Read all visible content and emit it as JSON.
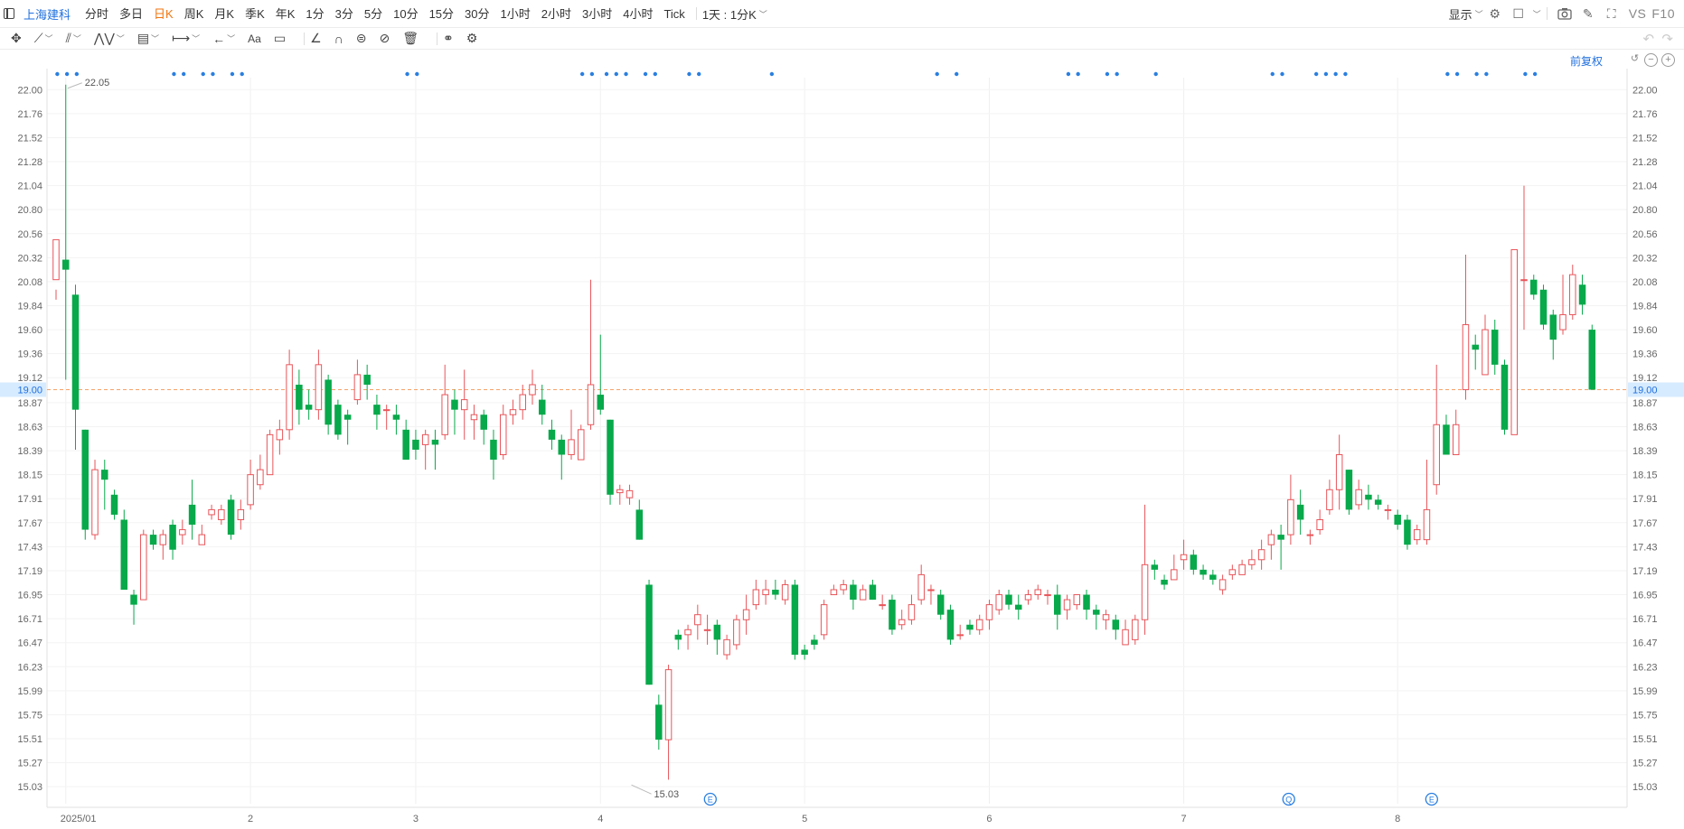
{
  "toolbar": {
    "symbol": "上海建科",
    "intervals": [
      "分时",
      "多日",
      "日K",
      "周K",
      "月K",
      "季K",
      "年K",
      "1分",
      "3分",
      "5分",
      "10分",
      "15分",
      "30分",
      "1小时",
      "2小时",
      "3小时",
      "4小时",
      "Tick"
    ],
    "active_interval": "日K",
    "range_label": "1天 : 1分K",
    "display_label": "显示",
    "vs_label": "VS",
    "f10_label": "F10"
  },
  "chart_header": {
    "adjust_label": "前复权"
  },
  "chart_data": {
    "type": "candlestick",
    "y_ticks": [
      22.0,
      21.76,
      21.52,
      21.28,
      21.04,
      20.8,
      20.56,
      20.32,
      20.08,
      19.84,
      19.6,
      19.36,
      19.12,
      18.87,
      18.63,
      18.39,
      18.15,
      17.91,
      17.67,
      17.43,
      17.19,
      16.95,
      16.71,
      16.47,
      16.23,
      15.99,
      15.75,
      15.51,
      15.27,
      15.03
    ],
    "ylim": [
      14.86,
      22.12
    ],
    "x_labels": [
      {
        "label": "2025/01",
        "i": 1
      },
      {
        "label": "2",
        "i": 20
      },
      {
        "label": "3",
        "i": 37
      },
      {
        "label": "4",
        "i": 56
      },
      {
        "label": "5",
        "i": 77
      },
      {
        "label": "6",
        "i": 96
      },
      {
        "label": "7",
        "i": 116
      },
      {
        "label": "8",
        "i": 138
      }
    ],
    "current_price": 19.0,
    "high_marker": {
      "value": "22.05",
      "i": 1
    },
    "low_marker": {
      "value": "15.03",
      "i": 59
    },
    "up_color": "#e8555a",
    "down_color": "#07a94a",
    "price_line_color": "#f5a36a",
    "candles": [
      [
        20.1,
        20.5,
        19.9,
        20.0
      ],
      [
        20.3,
        20.2,
        19.1,
        22.05
      ],
      [
        19.95,
        18.8,
        18.4,
        20.05
      ],
      [
        18.6,
        17.6,
        17.5,
        18.6
      ],
      [
        17.55,
        18.2,
        17.5,
        18.3
      ],
      [
        18.2,
        18.1,
        17.8,
        18.3
      ],
      [
        17.95,
        17.75,
        17.7,
        18.0
      ],
      [
        17.7,
        17.0,
        17.0,
        17.8
      ],
      [
        16.95,
        16.85,
        16.65,
        17.0
      ],
      [
        16.9,
        17.55,
        16.9,
        17.6
      ],
      [
        17.55,
        17.45,
        17.4,
        17.6
      ],
      [
        17.45,
        17.55,
        17.3,
        17.6
      ],
      [
        17.65,
        17.4,
        17.3,
        17.7
      ],
      [
        17.55,
        17.6,
        17.45,
        17.7
      ],
      [
        17.85,
        17.65,
        17.5,
        18.1
      ],
      [
        17.45,
        17.55,
        17.45,
        17.65
      ],
      [
        17.75,
        17.8,
        17.7,
        17.85
      ],
      [
        17.7,
        17.8,
        17.65,
        17.85
      ],
      [
        17.9,
        17.55,
        17.5,
        17.95
      ],
      [
        17.7,
        17.8,
        17.6,
        17.9
      ],
      [
        17.85,
        18.15,
        17.8,
        18.3
      ],
      [
        18.05,
        18.2,
        18.0,
        18.35
      ],
      [
        18.15,
        18.55,
        18.15,
        18.6
      ],
      [
        18.5,
        18.6,
        18.35,
        18.7
      ],
      [
        18.6,
        19.25,
        18.5,
        19.4
      ],
      [
        19.05,
        18.8,
        18.65,
        19.2
      ],
      [
        18.85,
        18.8,
        18.7,
        19.0
      ],
      [
        18.8,
        19.25,
        18.7,
        19.4
      ],
      [
        19.1,
        18.65,
        18.55,
        19.15
      ],
      [
        18.85,
        18.55,
        18.5,
        18.9
      ],
      [
        18.75,
        18.7,
        18.45,
        18.8
      ],
      [
        18.9,
        19.15,
        18.85,
        19.3
      ],
      [
        19.15,
        19.05,
        18.9,
        19.25
      ],
      [
        18.85,
        18.75,
        18.6,
        18.95
      ],
      [
        18.8,
        18.8,
        18.6,
        18.85
      ],
      [
        18.75,
        18.7,
        18.55,
        18.85
      ],
      [
        18.6,
        18.3,
        18.3,
        18.7
      ],
      [
        18.5,
        18.4,
        18.3,
        18.6
      ],
      [
        18.45,
        18.55,
        18.2,
        18.6
      ],
      [
        18.5,
        18.45,
        18.2,
        18.6
      ],
      [
        18.55,
        18.95,
        18.5,
        19.25
      ],
      [
        18.9,
        18.8,
        18.55,
        19.0
      ],
      [
        18.8,
        18.9,
        18.5,
        19.2
      ],
      [
        18.7,
        18.75,
        18.5,
        18.85
      ],
      [
        18.75,
        18.6,
        18.45,
        18.8
      ],
      [
        18.5,
        18.3,
        18.1,
        18.6
      ],
      [
        18.35,
        18.75,
        18.3,
        18.85
      ],
      [
        18.75,
        18.8,
        18.65,
        18.9
      ],
      [
        18.8,
        18.95,
        18.7,
        19.05
      ],
      [
        18.95,
        19.05,
        18.85,
        19.2
      ],
      [
        18.9,
        18.75,
        18.65,
        19.05
      ],
      [
        18.6,
        18.5,
        18.4,
        18.7
      ],
      [
        18.5,
        18.35,
        18.1,
        18.55
      ],
      [
        18.35,
        18.5,
        18.3,
        18.8
      ],
      [
        18.3,
        18.6,
        18.3,
        18.65
      ],
      [
        18.65,
        19.05,
        18.6,
        20.1
      ],
      [
        18.95,
        18.8,
        18.75,
        19.55
      ],
      [
        18.7,
        17.95,
        17.85,
        18.7
      ],
      [
        17.97,
        18.0,
        17.85,
        18.05
      ],
      [
        17.92,
        17.99,
        17.85,
        18.05
      ],
      [
        17.8,
        17.5,
        17.5,
        17.9
      ],
      [
        17.05,
        16.05,
        16.05,
        17.1
      ],
      [
        15.85,
        15.5,
        15.4,
        15.95
      ],
      [
        15.5,
        16.2,
        15.1,
        16.25
      ],
      [
        16.55,
        16.5,
        16.4,
        16.6
      ],
      [
        16.55,
        16.6,
        16.4,
        16.65
      ],
      [
        16.65,
        16.75,
        16.5,
        16.85
      ],
      [
        16.6,
        16.6,
        16.45,
        16.75
      ],
      [
        16.65,
        16.5,
        16.35,
        16.7
      ],
      [
        16.35,
        16.5,
        16.3,
        16.55
      ],
      [
        16.45,
        16.7,
        16.4,
        16.75
      ],
      [
        16.7,
        16.8,
        16.55,
        16.95
      ],
      [
        16.85,
        17.0,
        16.8,
        17.1
      ],
      [
        16.95,
        17.0,
        16.85,
        17.1
      ],
      [
        17.0,
        16.95,
        16.9,
        17.1
      ],
      [
        16.9,
        17.05,
        16.85,
        17.1
      ],
      [
        17.05,
        16.35,
        16.3,
        17.1
      ],
      [
        16.4,
        16.35,
        16.3,
        16.45
      ],
      [
        16.5,
        16.45,
        16.4,
        16.55
      ],
      [
        16.55,
        16.85,
        16.5,
        16.9
      ],
      [
        16.95,
        17.0,
        16.95,
        17.05
      ],
      [
        17.0,
        17.05,
        16.95,
        17.1
      ],
      [
        17.05,
        16.9,
        16.8,
        17.1
      ],
      [
        16.9,
        17.0,
        16.9,
        17.05
      ],
      [
        17.05,
        16.9,
        16.9,
        17.1
      ],
      [
        16.85,
        16.85,
        16.8,
        16.95
      ],
      [
        16.9,
        16.6,
        16.55,
        16.95
      ],
      [
        16.65,
        16.7,
        16.6,
        16.8
      ],
      [
        16.7,
        16.85,
        16.65,
        16.95
      ],
      [
        16.9,
        17.15,
        16.85,
        17.25
      ],
      [
        17.0,
        17.0,
        16.85,
        17.05
      ],
      [
        16.95,
        16.75,
        16.7,
        17.0
      ],
      [
        16.8,
        16.5,
        16.45,
        16.85
      ],
      [
        16.55,
        16.55,
        16.5,
        16.65
      ],
      [
        16.65,
        16.6,
        16.55,
        16.7
      ],
      [
        16.6,
        16.7,
        16.55,
        16.75
      ],
      [
        16.7,
        16.85,
        16.6,
        16.9
      ],
      [
        16.8,
        16.95,
        16.75,
        17.0
      ],
      [
        16.95,
        16.85,
        16.8,
        17.0
      ],
      [
        16.85,
        16.8,
        16.7,
        16.95
      ],
      [
        16.9,
        16.95,
        16.85,
        17.0
      ],
      [
        16.95,
        17.0,
        16.9,
        17.05
      ],
      [
        16.95,
        16.95,
        16.85,
        17.0
      ],
      [
        16.95,
        16.75,
        16.6,
        17.05
      ],
      [
        16.8,
        16.9,
        16.7,
        16.95
      ],
      [
        16.85,
        16.95,
        16.8,
        16.95
      ],
      [
        16.95,
        16.8,
        16.7,
        17.0
      ],
      [
        16.8,
        16.75,
        16.6,
        16.85
      ],
      [
        16.7,
        16.75,
        16.6,
        16.8
      ],
      [
        16.7,
        16.6,
        16.5,
        16.75
      ],
      [
        16.45,
        16.6,
        16.45,
        16.7
      ],
      [
        16.5,
        16.7,
        16.45,
        16.75
      ],
      [
        16.7,
        17.25,
        16.55,
        17.85
      ],
      [
        17.25,
        17.2,
        17.1,
        17.3
      ],
      [
        17.1,
        17.05,
        17.0,
        17.15
      ],
      [
        17.1,
        17.2,
        17.1,
        17.35
      ],
      [
        17.3,
        17.35,
        17.2,
        17.5
      ],
      [
        17.35,
        17.2,
        17.15,
        17.4
      ],
      [
        17.2,
        17.15,
        17.1,
        17.25
      ],
      [
        17.15,
        17.1,
        17.05,
        17.2
      ],
      [
        17.0,
        17.1,
        16.95,
        17.15
      ],
      [
        17.15,
        17.2,
        17.1,
        17.25
      ],
      [
        17.15,
        17.25,
        17.15,
        17.3
      ],
      [
        17.25,
        17.3,
        17.2,
        17.4
      ],
      [
        17.3,
        17.4,
        17.2,
        17.5
      ],
      [
        17.45,
        17.55,
        17.3,
        17.6
      ],
      [
        17.55,
        17.5,
        17.2,
        17.65
      ],
      [
        17.55,
        17.9,
        17.45,
        18.15
      ],
      [
        17.85,
        17.7,
        17.55,
        18.0
      ],
      [
        17.55,
        17.55,
        17.45,
        17.6
      ],
      [
        17.6,
        17.7,
        17.55,
        17.8
      ],
      [
        17.8,
        18.0,
        17.75,
        18.1
      ],
      [
        18.0,
        18.35,
        17.8,
        18.55
      ],
      [
        18.2,
        17.8,
        17.75,
        18.2
      ],
      [
        17.85,
        18.0,
        17.8,
        18.1
      ],
      [
        17.95,
        17.9,
        17.8,
        18.05
      ],
      [
        17.9,
        17.85,
        17.8,
        17.95
      ],
      [
        17.8,
        17.8,
        17.7,
        17.85
      ],
      [
        17.75,
        17.65,
        17.6,
        17.8
      ],
      [
        17.7,
        17.45,
        17.4,
        17.75
      ],
      [
        17.5,
        17.6,
        17.45,
        17.65
      ],
      [
        17.5,
        17.8,
        17.45,
        18.3
      ],
      [
        18.05,
        18.65,
        17.95,
        19.25
      ],
      [
        18.65,
        18.35,
        18.35,
        18.75
      ],
      [
        18.35,
        18.65,
        18.35,
        18.8
      ],
      [
        19.0,
        19.65,
        18.9,
        20.35
      ],
      [
        19.45,
        19.4,
        19.2,
        19.55
      ],
      [
        19.15,
        19.6,
        19.15,
        19.75
      ],
      [
        19.6,
        19.25,
        19.15,
        19.7
      ],
      [
        19.25,
        18.6,
        18.55,
        19.3
      ],
      [
        18.55,
        20.4,
        18.55,
        20.4
      ],
      [
        20.1,
        20.1,
        19.6,
        21.04
      ],
      [
        20.1,
        19.95,
        19.9,
        20.15
      ],
      [
        20.0,
        19.65,
        19.6,
        20.05
      ],
      [
        19.75,
        19.5,
        19.3,
        19.8
      ],
      [
        19.6,
        19.75,
        19.55,
        20.15
      ],
      [
        19.75,
        20.15,
        19.7,
        20.25
      ],
      [
        20.05,
        19.85,
        19.75,
        20.15
      ],
      [
        19.6,
        19.0,
        19.0,
        19.65
      ]
    ],
    "event_badges": [
      {
        "label": "E",
        "i": 67.3
      },
      {
        "label": "Q",
        "i": 126.8
      },
      {
        "label": "E",
        "i": 141.5
      }
    ],
    "dot_markers": [
      [
        0.5,
        1.5,
        2.5
      ],
      [
        12.5,
        13.5
      ],
      [
        15.5,
        16.5
      ],
      [
        18.5,
        19.5
      ],
      [
        36.5,
        37.5
      ],
      [
        54.5,
        55.5
      ],
      [
        57,
        58,
        59
      ],
      [
        61,
        62
      ],
      [
        65.5,
        66.5
      ],
      [
        74
      ],
      [
        91
      ],
      [
        93
      ],
      [
        104.5,
        105.5
      ],
      [
        108.5,
        109.5
      ],
      [
        113.5
      ],
      [
        125.5,
        126.5
      ],
      [
        130,
        131,
        132,
        133
      ],
      [
        143.5,
        144.5
      ],
      [
        146.5,
        147.5
      ],
      [
        151.5,
        152.5
      ]
    ]
  }
}
